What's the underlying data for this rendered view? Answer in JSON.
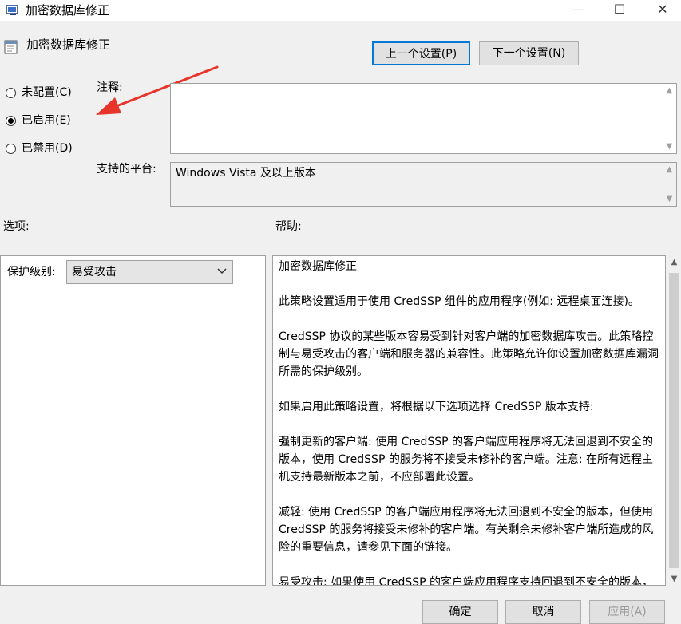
{
  "window": {
    "title": "加密数据库修正",
    "controls": {
      "minimize": "—",
      "maximize": "☐",
      "close": "✕"
    }
  },
  "header": {
    "title": "加密数据库修正",
    "prev_button": "上一个设置(P)",
    "next_button": "下一个设置(N)"
  },
  "radio_options": [
    {
      "label": "未配置(C)",
      "selected": false
    },
    {
      "label": "已启用(E)",
      "selected": true
    },
    {
      "label": "已禁用(D)",
      "selected": false
    }
  ],
  "comment": {
    "label": "注释:",
    "value": ""
  },
  "platform": {
    "label": "支持的平台:",
    "value": "Windows Vista 及以上版本"
  },
  "options": {
    "label": "选项:",
    "protection_level_label": "保护级别:",
    "protection_level_value": "易受攻击"
  },
  "help": {
    "label": "帮助:",
    "paragraphs": [
      "加密数据库修正",
      "此策略设置适用于使用 CredSSP 组件的应用程序(例如: 远程桌面连接)。",
      "CredSSP 协议的某些版本容易受到针对客户端的加密数据库攻击。此策略控制与易受攻击的客户端和服务器的兼容性。此策略允许你设置加密数据库漏洞所需的保护级别。",
      "如果启用此策略设置，将根据以下选项选择 CredSSP 版本支持:",
      "强制更新的客户端: 使用 CredSSP 的客户端应用程序将无法回退到不安全的版本，使用 CredSSP 的服务将不接受未修补的客户端。注意: 在所有远程主机支持最新版本之前，不应部署此设置。",
      "减轻: 使用 CredSSP 的客户端应用程序将无法回退到不安全的版本，但使用 CredSSP 的服务将接受未修补的客户端。有关剩余未修补客户端所造成的风险的重要信息，请参见下面的链接。",
      "易受攻击: 如果使用 CredSSP 的客户端应用程序支持回退到不安全的版本，远程服务器将容易受到攻击。使用 CredSSP 的服务将接受未修补的客户端。"
    ]
  },
  "footer": {
    "ok": "确定",
    "cancel": "取消",
    "apply": "应用(A)"
  },
  "colors": {
    "focus_border": "#0078d7",
    "arrow": "#e8352b",
    "background": "#f0f0f0"
  },
  "icons": {
    "title": "policy-window-icon",
    "header": "policy-setting-icon"
  }
}
